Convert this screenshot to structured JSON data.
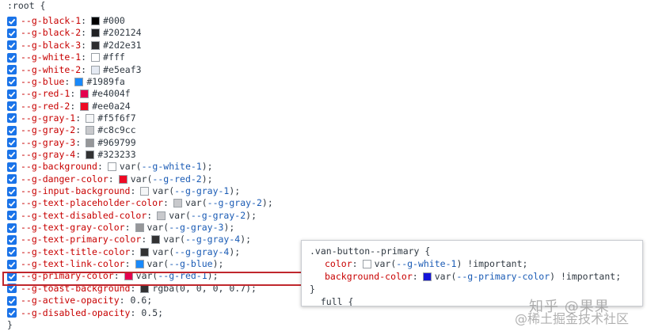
{
  "rule": {
    "selector_open": ":root {",
    "close": "}",
    "declarations": [
      {
        "prop": "--g-black-1",
        "swatch": "#000000",
        "parts": [
          {
            "t": "#000",
            "k": "val"
          }
        ]
      },
      {
        "prop": "--g-black-2",
        "swatch": "#202124",
        "parts": [
          {
            "t": "#202124",
            "k": "val"
          }
        ]
      },
      {
        "prop": "--g-black-3",
        "swatch": "#2d2e31",
        "parts": [
          {
            "t": "#2d2e31",
            "k": "val"
          }
        ]
      },
      {
        "prop": "--g-white-1",
        "swatch": "#ffffff",
        "parts": [
          {
            "t": "#fff",
            "k": "val"
          }
        ]
      },
      {
        "prop": "--g-white-2",
        "swatch": "#e5eaf3",
        "parts": [
          {
            "t": "#e5eaf3",
            "k": "val"
          }
        ]
      },
      {
        "prop": "--g-blue",
        "swatch": "#1989fa",
        "parts": [
          {
            "t": "#1989fa",
            "k": "val"
          }
        ]
      },
      {
        "prop": "--g-red-1",
        "swatch": "#e4004f",
        "parts": [
          {
            "t": "#e4004f",
            "k": "val"
          }
        ]
      },
      {
        "prop": "--g-red-2",
        "swatch": "#ee0a24",
        "parts": [
          {
            "t": "#ee0a24",
            "k": "val"
          }
        ]
      },
      {
        "prop": "--g-gray-1",
        "swatch": "#f5f6f7",
        "parts": [
          {
            "t": "#f5f6f7",
            "k": "val"
          }
        ]
      },
      {
        "prop": "--g-gray-2",
        "swatch": "#c8c9cc",
        "parts": [
          {
            "t": "#c8c9cc",
            "k": "val"
          }
        ]
      },
      {
        "prop": "--g-gray-3",
        "swatch": "#969799",
        "parts": [
          {
            "t": "#969799",
            "k": "val"
          }
        ]
      },
      {
        "prop": "--g-gray-4",
        "swatch": "#323233",
        "parts": [
          {
            "t": "#323233",
            "k": "val"
          }
        ]
      },
      {
        "prop": "--g-background",
        "swatch": "#ffffff",
        "parts": [
          {
            "t": "var(",
            "k": "val"
          },
          {
            "t": "--g-white-1",
            "k": "var"
          },
          {
            "t": ");",
            "k": "val"
          }
        ]
      },
      {
        "prop": "--g-danger-color",
        "swatch": "#ee0a24",
        "parts": [
          {
            "t": "var(",
            "k": "val"
          },
          {
            "t": "--g-red-2",
            "k": "var"
          },
          {
            "t": ");",
            "k": "val"
          }
        ]
      },
      {
        "prop": "--g-input-background",
        "swatch": "#f5f6f7",
        "parts": [
          {
            "t": "var(",
            "k": "val"
          },
          {
            "t": "--g-gray-1",
            "k": "var"
          },
          {
            "t": ");",
            "k": "val"
          }
        ]
      },
      {
        "prop": "--g-text-placeholder-color",
        "swatch": "#c8c9cc",
        "parts": [
          {
            "t": "var(",
            "k": "val"
          },
          {
            "t": "--g-gray-2",
            "k": "var"
          },
          {
            "t": ");",
            "k": "val"
          }
        ]
      },
      {
        "prop": "--g-text-disabled-color",
        "swatch": "#c8c9cc",
        "parts": [
          {
            "t": "var(",
            "k": "val"
          },
          {
            "t": "--g-gray-2",
            "k": "var"
          },
          {
            "t": ");",
            "k": "val"
          }
        ]
      },
      {
        "prop": "--g-text-gray-color",
        "swatch": "#969799",
        "parts": [
          {
            "t": "var(",
            "k": "val"
          },
          {
            "t": "--g-gray-3",
            "k": "var"
          },
          {
            "t": ");",
            "k": "val"
          }
        ]
      },
      {
        "prop": "--g-text-primary-color",
        "swatch": "#323233",
        "parts": [
          {
            "t": "var(",
            "k": "val"
          },
          {
            "t": "--g-gray-4",
            "k": "var"
          },
          {
            "t": ");",
            "k": "val"
          }
        ]
      },
      {
        "prop": "--g-text-title-color",
        "swatch": "#323233",
        "parts": [
          {
            "t": "var(",
            "k": "val"
          },
          {
            "t": "--g-gray-4",
            "k": "var"
          },
          {
            "t": ");",
            "k": "val"
          }
        ]
      },
      {
        "prop": "--g-text-link-color",
        "swatch": "#1989fa",
        "parts": [
          {
            "t": "var(",
            "k": "val"
          },
          {
            "t": "--g-blue",
            "k": "var"
          },
          {
            "t": ");",
            "k": "val"
          }
        ]
      },
      {
        "prop": "--g-primary-color",
        "swatch": "#e4004f",
        "highlight": true,
        "parts": [
          {
            "t": "var(",
            "k": "val"
          },
          {
            "t": "--g-red-1",
            "k": "var"
          },
          {
            "t": ");",
            "k": "val"
          }
        ]
      },
      {
        "prop": "--g-toast-background",
        "swatch": "#323233",
        "parts": [
          {
            "t": "rgba(0, 0, 0, 0.7);",
            "k": "val"
          }
        ]
      },
      {
        "prop": "--g-active-opacity",
        "swatch": null,
        "parts": [
          {
            "t": "0.6;",
            "k": "val"
          }
        ]
      },
      {
        "prop": "--g-disabled-opacity",
        "swatch": null,
        "parts": [
          {
            "t": "0.5;",
            "k": "val"
          }
        ]
      }
    ]
  },
  "popup": {
    "selector": ".van-button--primary {",
    "lines": [
      {
        "prop": "color",
        "swatch": "#ffffff",
        "parts": [
          {
            "t": "var(",
            "k": "val"
          },
          {
            "t": "--g-white-1",
            "k": "var"
          },
          {
            "t": ") !important;",
            "k": "val"
          }
        ]
      },
      {
        "prop": "background-color",
        "swatch": "#1414d8",
        "parts": [
          {
            "t": "var(",
            "k": "val"
          },
          {
            "t": "--g-primary-color",
            "k": "var"
          },
          {
            "t": ") !important;",
            "k": "val"
          }
        ]
      }
    ],
    "close": "}",
    "trailing": "  full {"
  },
  "watermark": {
    "line1": "知乎 @果果",
    "line2": "@稀土掘金技术社区"
  }
}
